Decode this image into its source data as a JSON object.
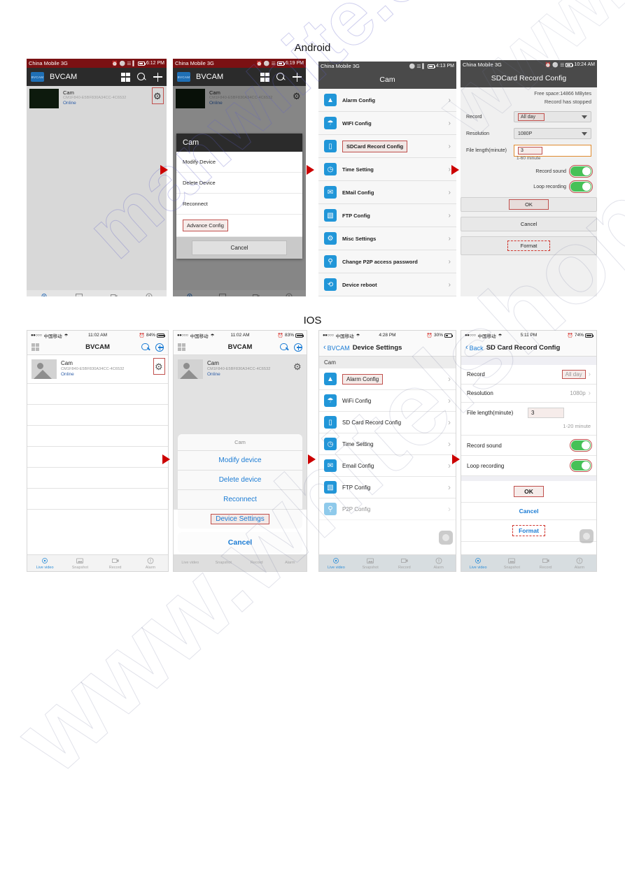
{
  "page": {
    "watermark": [
      "www.whitelshop.com",
      "manwhite.com",
      "manual"
    ],
    "sections": [
      {
        "id": "android",
        "title": "Android"
      },
      {
        "id": "ios",
        "title": "IOS"
      }
    ]
  },
  "common": {
    "device": {
      "name": "Cam",
      "id": "CM1F840-E5BF830A34CC-4C6532",
      "status": "Online"
    },
    "app_title": "BVCAM",
    "logo_text": "BVCAM",
    "tabs": [
      {
        "label": "Live video",
        "icon": "live-video-icon",
        "active": true
      },
      {
        "label": "Snapshot",
        "icon": "snapshot-icon",
        "active": false
      },
      {
        "label": "Record",
        "icon": "record-icon",
        "active": false
      },
      {
        "label": "Alarm",
        "icon": "alarm-icon",
        "active": false
      }
    ],
    "accent_blue": "#2196d8",
    "link_blue": "#1a7bd4",
    "highlight_red": "#c0504d",
    "toggle_green": "#46c157",
    "arrow_red": "#cc0000"
  },
  "android": {
    "screen1": {
      "status": {
        "carrier": "China Mobile 3G",
        "time": "6:12 PM",
        "icons": [
          "alarm-icon",
          "mute-icon",
          "wifi-icon",
          "signal-icon",
          "battery-icon"
        ]
      },
      "appbar": {
        "title": "BVCAM",
        "icons": [
          "grid-icon",
          "search-icon",
          "plus-icon"
        ]
      },
      "gear_button": "gear-icon"
    },
    "screen2": {
      "status": {
        "carrier": "China Mobile 3G",
        "time": "6:19 PM"
      },
      "appbar": {
        "title": "BVCAM"
      },
      "dialog": {
        "title": "Cam",
        "items": [
          "Modify Device",
          "Delete Device",
          "Reconnect",
          "Advance Config"
        ],
        "highlighted": "Advance Config",
        "cancel": "Cancel"
      }
    },
    "screen3": {
      "status": {
        "carrier": "China Mobile 3G",
        "time": "4:13 PM"
      },
      "title": "Cam",
      "items": [
        {
          "label": "Alarm Config",
          "icon": "alarm-triangle-icon"
        },
        {
          "label": "WIFI Config",
          "icon": "wifi-icon"
        },
        {
          "label": "SDCard Record Config",
          "icon": "sdcard-icon",
          "highlighted": true
        },
        {
          "label": "Time Setting",
          "icon": "clock-icon"
        },
        {
          "label": "EMail Config",
          "icon": "envelope-icon"
        },
        {
          "label": "FTP Config",
          "icon": "ftp-icon"
        },
        {
          "label": "Misc Settings",
          "icon": "gear-icon"
        },
        {
          "label": "Change P2P access password",
          "icon": "key-icon"
        },
        {
          "label": "Device reboot",
          "icon": "reboot-icon"
        }
      ]
    },
    "screen4": {
      "status": {
        "carrier": "China Mobile 3G",
        "time": "10:24 AM"
      },
      "title": "SDCard Record Config",
      "free_space": "Free space:14866 MBytes",
      "record_state": "Record has stopped",
      "rows": [
        {
          "label": "Record",
          "value": "All day",
          "type": "select",
          "highlighted": true
        },
        {
          "label": "Resolution",
          "value": "1080P",
          "type": "select"
        },
        {
          "label": "File length(minute)",
          "value": "3",
          "type": "input",
          "highlighted": true
        }
      ],
      "hint": "1-60 minute",
      "toggles": [
        {
          "label": "Record sound",
          "on": true
        },
        {
          "label": "Loop recording",
          "on": true
        }
      ],
      "buttons": [
        {
          "label": "OK",
          "highlighted": true
        },
        {
          "label": "Cancel",
          "highlighted": false
        },
        {
          "label": "Format",
          "highlighted": true,
          "dashed": true
        }
      ]
    }
  },
  "ios": {
    "screen1": {
      "status": {
        "signal": "●●○○○",
        "carrier": "中国移动",
        "time": "11:02 AM",
        "battery": "84%"
      },
      "navbar": {
        "title": "BVCAM",
        "icons": [
          "grid-icon",
          "search-icon",
          "plus-icon"
        ]
      },
      "gear_button": "gear-icon"
    },
    "screen2": {
      "status": {
        "signal": "●●○○○",
        "carrier": "中国移动",
        "time": "11:02 AM",
        "battery": "83%"
      },
      "navbar": {
        "title": "BVCAM"
      },
      "sheet": {
        "title": "Cam",
        "items": [
          "Modify device",
          "Delete device",
          "Reconnect",
          "Device Settings"
        ],
        "highlighted": "Device Settings",
        "cancel": "Cancel"
      }
    },
    "screen3": {
      "status": {
        "signal": "●●○○○",
        "carrier": "中国移动",
        "time": "4:28 PM",
        "battery": "30%"
      },
      "back_label": "BVCAM",
      "title": "Device Settings",
      "group_header": "Cam",
      "items": [
        {
          "label": "Alarm Config",
          "icon": "alarm-triangle-icon",
          "highlighted": true
        },
        {
          "label": "WiFi Config",
          "icon": "wifi-icon"
        },
        {
          "label": "SD Card Record Config",
          "icon": "sdcard-icon"
        },
        {
          "label": "Time Setting",
          "icon": "clock-icon"
        },
        {
          "label": "Email Config",
          "icon": "envelope-icon"
        },
        {
          "label": "FTP Config",
          "icon": "ftp-icon"
        },
        {
          "label": "P2P Config",
          "icon": "key-icon"
        }
      ]
    },
    "screen4": {
      "status": {
        "signal": "●●○○○",
        "carrier": "中国移动",
        "time": "5:11 PM",
        "battery": "74%"
      },
      "back_label": "Back",
      "title": "SD Card Record Config",
      "rows": [
        {
          "label": "Record",
          "value": "All day",
          "type": "select",
          "highlighted": true
        },
        {
          "label": "Resolution",
          "value": "1080p",
          "type": "select"
        },
        {
          "label": "File length(minute)",
          "value": "3",
          "type": "input",
          "highlighted": true
        }
      ],
      "hint": "1-20 minute",
      "toggles": [
        {
          "label": "Record sound",
          "on": true
        },
        {
          "label": "Loop recording",
          "on": true
        }
      ],
      "buttons": [
        {
          "label": "OK",
          "highlighted": true
        },
        {
          "label": "Cancel",
          "highlighted": false
        },
        {
          "label": "Format",
          "highlighted": true,
          "dashed": true
        }
      ]
    }
  }
}
